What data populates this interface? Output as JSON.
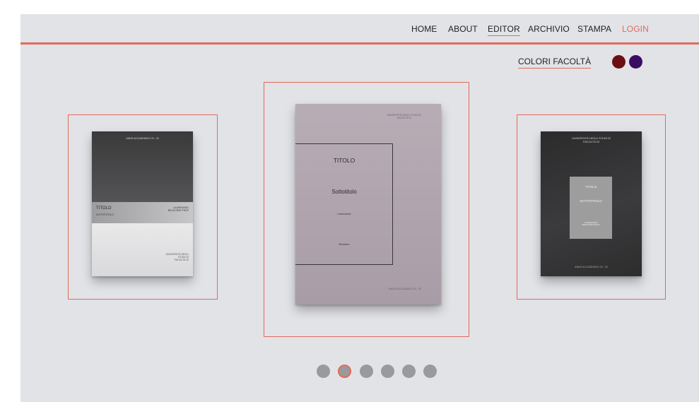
{
  "colors": {
    "accent": "#e26a5a",
    "background": "#e2e3e7",
    "faculty_dark_red": "#6b0f14",
    "faculty_purple": "#3c0c63",
    "dot": "#9a9a9c"
  },
  "nav": {
    "items": [
      {
        "label": "HOME"
      },
      {
        "label": "ABOUT"
      },
      {
        "label": "EDITOR",
        "active": true
      },
      {
        "label": "ARCHIVIO"
      },
      {
        "label": "STAMPA"
      },
      {
        "label": "LOGIN"
      }
    ]
  },
  "faculty_colors": {
    "label": "COLORI FACOLTÀ",
    "swatches": [
      "dark-red",
      "purple"
    ]
  },
  "slides": {
    "left": {
      "year": "ANNO ACCADEMICO 20 - 20",
      "title": "TITOLO",
      "subtitle": "SOTTOTITOLO",
      "people": "LAUREANDO\nRELATORE PROF",
      "university": "UNIVERSITÀ DEGLI\nSTUDI DI\nFACOLTÀ DI"
    },
    "center": {
      "university": "UNIVERSITÀ DEGLI STUDI DI\nFACOLTÀ DI",
      "title": "TITOLO",
      "subtitle": "Sottotitolo",
      "candidate": "Laureando",
      "supervisor": "Relatore",
      "year": "ANNO ACCADEMICO 20 - 20"
    },
    "right": {
      "university": "UNIVERSITÀ DEGLI STUDI DI\nFACOLTÀ DI",
      "title": "TITOLO",
      "subtitle": "SOTTOTITOLO",
      "people": "LAUREANDO\nRELATORE PROF",
      "year": "ANNO ACCADEMICO 20 - 20"
    }
  },
  "carousel": {
    "count": 6,
    "active_index": 1
  }
}
